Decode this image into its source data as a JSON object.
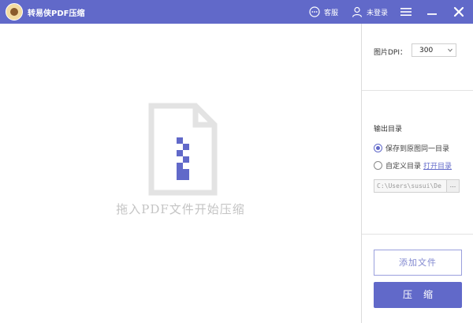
{
  "app": {
    "title": "转易侠PDF压缩"
  },
  "titlebar": {
    "service_label": "客服",
    "login_label": "未登录"
  },
  "main": {
    "drop_hint": "拖入PDF文件开始压缩"
  },
  "sidebar": {
    "dpi_label": "图片DPI：",
    "dpi_value": "300",
    "output_label": "输出目录",
    "radio_same_dir": "保存到原图同一目录",
    "radio_custom_dir": "自定义目录",
    "open_dir_link": "打开目录",
    "path_value": "C:\\Users\\susui\\De",
    "browse_label": "...",
    "add_file_button": "添加文件",
    "compress_button": "压缩"
  },
  "colors": {
    "accent": "#6169c9",
    "file_icon": "#e3e3e3",
    "zipper": "#6169c9"
  },
  "icons": {
    "logo": "app-logo",
    "service": "chat-bubble-icon",
    "login": "user-icon",
    "menu": "hamburger-menu-icon",
    "minimize": "minimize-icon",
    "close": "close-icon",
    "file": "zip-file-icon",
    "dropdown": "chevron-down-icon"
  }
}
